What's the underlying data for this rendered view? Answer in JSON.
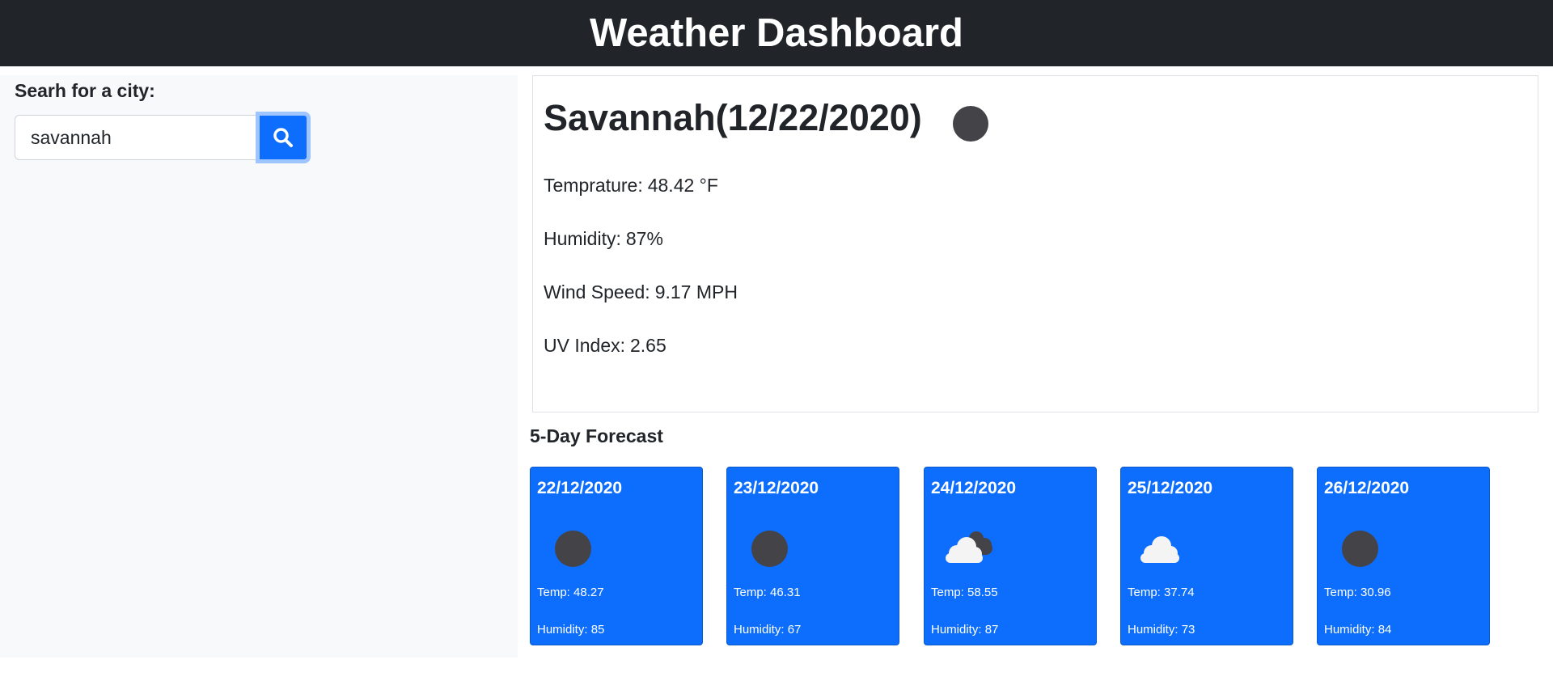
{
  "header": {
    "title": "Weather Dashboard"
  },
  "search": {
    "label": "Searh for a city:",
    "value": "savannah",
    "button_icon": "search-icon"
  },
  "current": {
    "title": "Savannah(12/22/2020)",
    "icon": "clear-night-dot-icon",
    "temperature_label": "Temprature:",
    "temperature": "48.42 °F",
    "humidity_label": "Humidity:",
    "humidity": "87%",
    "wind_label": "Wind Speed:",
    "wind": "9.17 MPH",
    "uv_label": "UV Index:",
    "uv": "2.65"
  },
  "forecast": {
    "title": "5-Day Forecast",
    "temp_label": "Temp:",
    "humidity_label": "Humidity:",
    "days": [
      {
        "date": "22/12/2020",
        "icon": "clear-night-dot-icon",
        "temp": "48.27",
        "humidity": "85"
      },
      {
        "date": "23/12/2020",
        "icon": "clear-night-dot-icon",
        "temp": "46.31",
        "humidity": "67"
      },
      {
        "date": "24/12/2020",
        "icon": "broken-clouds-icon",
        "temp": "58.55",
        "humidity": "87"
      },
      {
        "date": "25/12/2020",
        "icon": "cloud-icon",
        "temp": "37.74",
        "humidity": "73"
      },
      {
        "date": "26/12/2020",
        "icon": "clear-night-dot-icon",
        "temp": "30.96",
        "humidity": "84"
      }
    ]
  },
  "colors": {
    "header_bg": "#212529",
    "card_bg": "#0d6efd",
    "sidebar_bg": "#f8f9fa",
    "icon_dark": "#444448"
  }
}
